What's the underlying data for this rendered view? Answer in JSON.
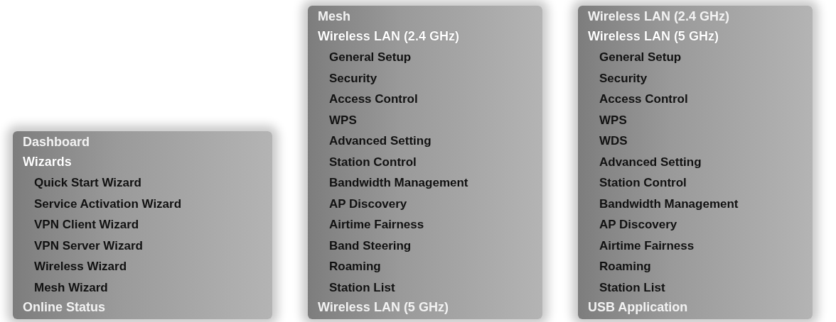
{
  "panels": [
    {
      "above": "Dashboard",
      "heading": "Wizards",
      "items": [
        "Quick Start Wizard",
        "Service Activation Wizard",
        "VPN Client Wizard",
        "VPN Server Wizard",
        "Wireless Wizard",
        "Mesh Wizard"
      ],
      "below": "Online Status"
    },
    {
      "above": "Mesh",
      "heading": "Wireless LAN (2.4 GHz)",
      "items": [
        "General Setup",
        "Security",
        "Access Control",
        "WPS",
        "Advanced Setting",
        "Station Control",
        "Bandwidth Management",
        "AP Discovery",
        "Airtime Fairness",
        "Band Steering",
        "Roaming",
        "Station List"
      ],
      "below": "Wireless LAN (5 GHz)"
    },
    {
      "above": "Wireless LAN (2.4 GHz)",
      "heading": "Wireless LAN (5 GHz)",
      "items": [
        "General Setup",
        "Security",
        "Access Control",
        "WPS",
        "WDS",
        "Advanced Setting",
        "Station Control",
        "Bandwidth Management",
        "AP Discovery",
        "Airtime Fairness",
        "Roaming",
        "Station List"
      ],
      "below": "USB Application"
    }
  ]
}
